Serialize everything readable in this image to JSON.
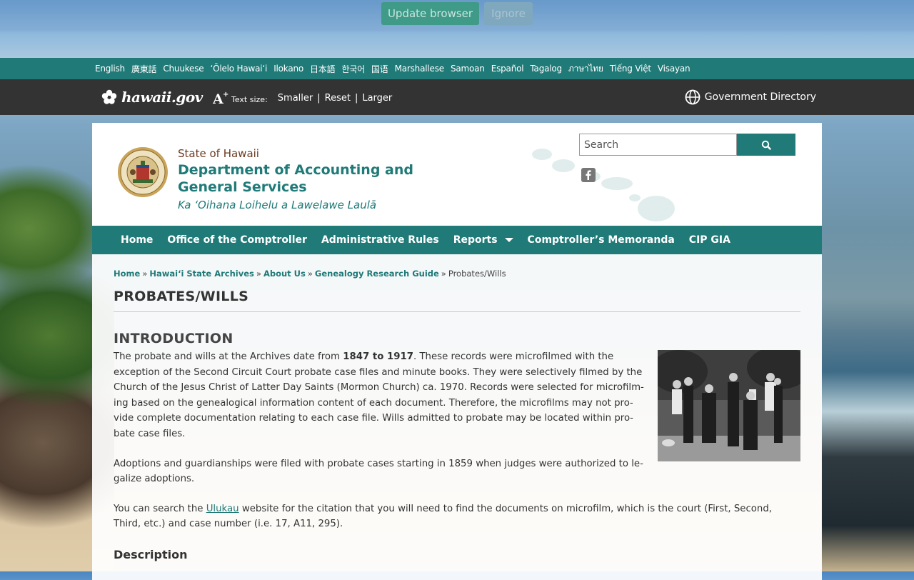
{
  "update_bar": {
    "update_label": "Update browser",
    "ignore_label": "Ignore"
  },
  "languages": [
    "English",
    "廣東話",
    "Chuukese",
    "ʻŌlelo Hawaiʻi",
    "Ilokano",
    "日本語",
    "한국어",
    "国语",
    "Marshallese",
    "Samoan",
    "Español",
    "Tagalog",
    "ภาษาไทย",
    "Tiếng Việt",
    "Visayan"
  ],
  "portal": {
    "logo_text": "hawaii.gov",
    "text_size_label": "Text size:",
    "smaller": "Smaller",
    "reset": "Reset",
    "larger": "Larger",
    "gov_directory": "Government Directory"
  },
  "header": {
    "state": "State of Hawaii",
    "department": "Department of Accounting and General Services",
    "hawaiian_name": "Ka ʻOihana Loihelu a Lawelawe Laulā",
    "search_placeholder": "Search"
  },
  "nav": {
    "items": [
      "Home",
      "Office of the Comptroller",
      "Administrative Rules",
      "Reports",
      "Comptroller’s Memoranda",
      "CIP GIA"
    ]
  },
  "breadcrumb": {
    "items": [
      "Home",
      "Hawaiʻi State Archives",
      "About Us",
      "Genealogy Research Guide"
    ],
    "current": "Probates/Wills",
    "separator": "»"
  },
  "page": {
    "title": "PROBATES/WILLS",
    "intro_heading": "INTRODUCTION",
    "p1_before": "The probate and wills at the Archives date from ",
    "p1_bold": "1847 to 1917",
    "p1_after": ".  These records were microfilmed with the excep­tion of the Second Circuit Court probate case files and minute books.  They were selectively filmed by the Church of the Jesus Christ of Latter Day Saints (Mormon Church) ca. 1970. Records were selected for microfilm­ing based on the genealogical information content of each document.  Therefore, the microfilms may not pro­vide complete documentation relating to each case file.  Wills admitted to probate may be located within pro­bate case files.",
    "p2": "Adoptions and guardianships were filed with probate cases starting in 1859 when judges were authorized to le­galize adoptions.",
    "p3_before": "You can search the ",
    "p3_link": "Ulukau",
    "p3_after": " website for the citation that you will need to find the documents on microfilm, which is the court (First, Second, Third, etc.) and case number (i.e. 17, A11, 295).",
    "description_heading": "Description"
  },
  "colors": {
    "teal": "#1f7a78",
    "dark_bar": "#333333",
    "state_brown": "#6b3a20"
  },
  "icons": {
    "logo": "hibiscus-icon",
    "text_size": "text-size-icon",
    "globe": "globe-icon",
    "search": "search-icon",
    "facebook": "facebook-icon",
    "seal": "state-seal-icon"
  }
}
